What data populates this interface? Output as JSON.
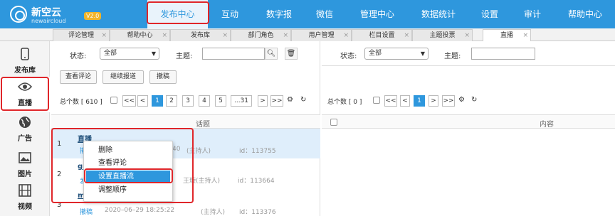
{
  "brand": {
    "name": "新空云",
    "sub": "newaircloud",
    "version": "V2.0"
  },
  "nav": [
    "发布中心",
    "互动",
    "数字报",
    "微信",
    "管理中心",
    "数据统计",
    "设置",
    "审计",
    "帮助中心"
  ],
  "tabs": [
    "评论管理",
    "帮助中心",
    "发布库",
    "部门角色",
    "用户管理",
    "栏目设置",
    "主题投票",
    "直播"
  ],
  "sidebar": [
    {
      "label": "发布库",
      "icon": "phone-icon"
    },
    {
      "label": "直播",
      "icon": "eye-icon"
    },
    {
      "label": "广告",
      "icon": "globe-icon"
    },
    {
      "label": "图片",
      "icon": "image-icon"
    },
    {
      "label": "视频",
      "icon": "film-icon"
    }
  ],
  "left": {
    "status_label": "状态:",
    "status_value": "全部",
    "subject_label": "主题:",
    "buttons": [
      "查看评论",
      "继续报道",
      "撤稿"
    ],
    "total": "总个数 [ 610 ]",
    "pages": [
      "<<",
      "<",
      "1",
      "2",
      "3",
      "4",
      "5",
      "...31",
      ">",
      ">>"
    ],
    "col_title": "话题",
    "rows": [
      {
        "num": "1",
        "title": "直播",
        "op": "撤",
        "time": "40",
        "host": "(主持人)",
        "id": "id：113755"
      },
      {
        "num": "2",
        "title": "gi",
        "op": "发",
        "time": "",
        "host": "王璇(主持人)",
        "id": "id：113664"
      },
      {
        "num": "3",
        "title": "me",
        "op": "撤稿",
        "time": "2020–06–29 18:25:22",
        "host": "(主持人)",
        "id": "id：113376"
      }
    ]
  },
  "right": {
    "status_label": "状态:",
    "status_value": "全部",
    "subject_label": "主题:",
    "total": "总个数 [ 0 ]",
    "pages": [
      "<<",
      "<",
      "1",
      ">",
      ">>"
    ],
    "col_content": "内容"
  },
  "context_menu": [
    "删除",
    "查看评论",
    "设置直播流",
    "调整顺序"
  ]
}
